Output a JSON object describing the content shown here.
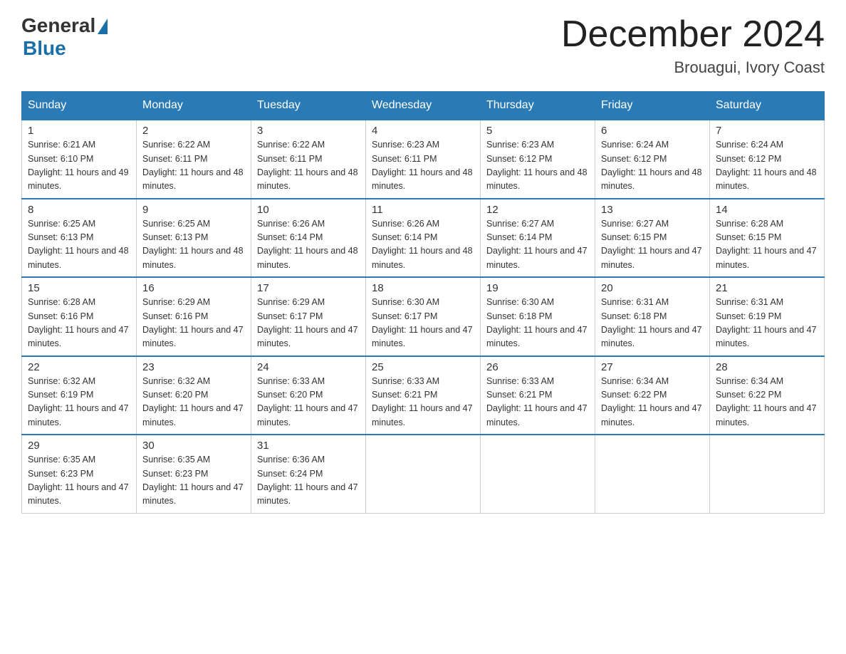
{
  "header": {
    "logo": {
      "general": "General",
      "blue": "Blue"
    },
    "title": "December 2024",
    "location": "Brouagui, Ivory Coast"
  },
  "days_of_week": [
    "Sunday",
    "Monday",
    "Tuesday",
    "Wednesday",
    "Thursday",
    "Friday",
    "Saturday"
  ],
  "weeks": [
    [
      {
        "day": "1",
        "sunrise": "6:21 AM",
        "sunset": "6:10 PM",
        "daylight": "11 hours and 49 minutes."
      },
      {
        "day": "2",
        "sunrise": "6:22 AM",
        "sunset": "6:11 PM",
        "daylight": "11 hours and 48 minutes."
      },
      {
        "day": "3",
        "sunrise": "6:22 AM",
        "sunset": "6:11 PM",
        "daylight": "11 hours and 48 minutes."
      },
      {
        "day": "4",
        "sunrise": "6:23 AM",
        "sunset": "6:11 PM",
        "daylight": "11 hours and 48 minutes."
      },
      {
        "day": "5",
        "sunrise": "6:23 AM",
        "sunset": "6:12 PM",
        "daylight": "11 hours and 48 minutes."
      },
      {
        "day": "6",
        "sunrise": "6:24 AM",
        "sunset": "6:12 PM",
        "daylight": "11 hours and 48 minutes."
      },
      {
        "day": "7",
        "sunrise": "6:24 AM",
        "sunset": "6:12 PM",
        "daylight": "11 hours and 48 minutes."
      }
    ],
    [
      {
        "day": "8",
        "sunrise": "6:25 AM",
        "sunset": "6:13 PM",
        "daylight": "11 hours and 48 minutes."
      },
      {
        "day": "9",
        "sunrise": "6:25 AM",
        "sunset": "6:13 PM",
        "daylight": "11 hours and 48 minutes."
      },
      {
        "day": "10",
        "sunrise": "6:26 AM",
        "sunset": "6:14 PM",
        "daylight": "11 hours and 48 minutes."
      },
      {
        "day": "11",
        "sunrise": "6:26 AM",
        "sunset": "6:14 PM",
        "daylight": "11 hours and 48 minutes."
      },
      {
        "day": "12",
        "sunrise": "6:27 AM",
        "sunset": "6:14 PM",
        "daylight": "11 hours and 47 minutes."
      },
      {
        "day": "13",
        "sunrise": "6:27 AM",
        "sunset": "6:15 PM",
        "daylight": "11 hours and 47 minutes."
      },
      {
        "day": "14",
        "sunrise": "6:28 AM",
        "sunset": "6:15 PM",
        "daylight": "11 hours and 47 minutes."
      }
    ],
    [
      {
        "day": "15",
        "sunrise": "6:28 AM",
        "sunset": "6:16 PM",
        "daylight": "11 hours and 47 minutes."
      },
      {
        "day": "16",
        "sunrise": "6:29 AM",
        "sunset": "6:16 PM",
        "daylight": "11 hours and 47 minutes."
      },
      {
        "day": "17",
        "sunrise": "6:29 AM",
        "sunset": "6:17 PM",
        "daylight": "11 hours and 47 minutes."
      },
      {
        "day": "18",
        "sunrise": "6:30 AM",
        "sunset": "6:17 PM",
        "daylight": "11 hours and 47 minutes."
      },
      {
        "day": "19",
        "sunrise": "6:30 AM",
        "sunset": "6:18 PM",
        "daylight": "11 hours and 47 minutes."
      },
      {
        "day": "20",
        "sunrise": "6:31 AM",
        "sunset": "6:18 PM",
        "daylight": "11 hours and 47 minutes."
      },
      {
        "day": "21",
        "sunrise": "6:31 AM",
        "sunset": "6:19 PM",
        "daylight": "11 hours and 47 minutes."
      }
    ],
    [
      {
        "day": "22",
        "sunrise": "6:32 AM",
        "sunset": "6:19 PM",
        "daylight": "11 hours and 47 minutes."
      },
      {
        "day": "23",
        "sunrise": "6:32 AM",
        "sunset": "6:20 PM",
        "daylight": "11 hours and 47 minutes."
      },
      {
        "day": "24",
        "sunrise": "6:33 AM",
        "sunset": "6:20 PM",
        "daylight": "11 hours and 47 minutes."
      },
      {
        "day": "25",
        "sunrise": "6:33 AM",
        "sunset": "6:21 PM",
        "daylight": "11 hours and 47 minutes."
      },
      {
        "day": "26",
        "sunrise": "6:33 AM",
        "sunset": "6:21 PM",
        "daylight": "11 hours and 47 minutes."
      },
      {
        "day": "27",
        "sunrise": "6:34 AM",
        "sunset": "6:22 PM",
        "daylight": "11 hours and 47 minutes."
      },
      {
        "day": "28",
        "sunrise": "6:34 AM",
        "sunset": "6:22 PM",
        "daylight": "11 hours and 47 minutes."
      }
    ],
    [
      {
        "day": "29",
        "sunrise": "6:35 AM",
        "sunset": "6:23 PM",
        "daylight": "11 hours and 47 minutes."
      },
      {
        "day": "30",
        "sunrise": "6:35 AM",
        "sunset": "6:23 PM",
        "daylight": "11 hours and 47 minutes."
      },
      {
        "day": "31",
        "sunrise": "6:36 AM",
        "sunset": "6:24 PM",
        "daylight": "11 hours and 47 minutes."
      },
      null,
      null,
      null,
      null
    ]
  ]
}
